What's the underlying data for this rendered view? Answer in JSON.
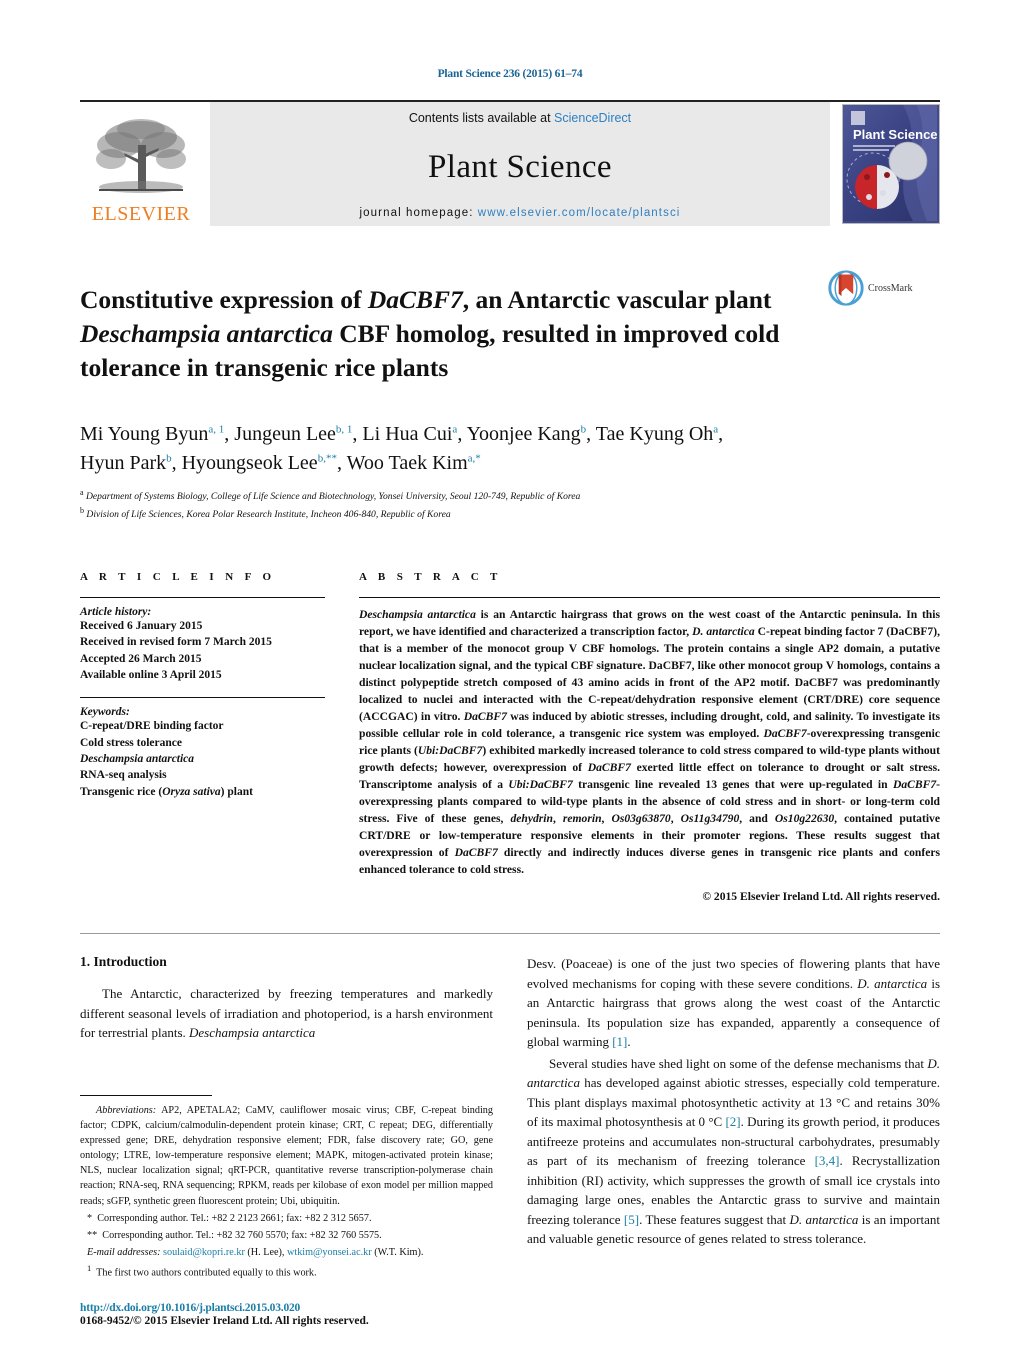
{
  "running_head": "Plant Science 236 (2015) 61–74",
  "masthead": {
    "contents_prefix": "Contents lists available at ",
    "contents_link": "ScienceDirect",
    "journal_title": "Plant Science",
    "homepage_prefix": "journal homepage: ",
    "homepage_url": "www.elsevier.com/locate/plantsci",
    "publisher_name": "ELSEVIER",
    "cover_title": "Plant Science",
    "cover_subtitle": "AN INTERNATIONAL JOURNAL OF EXPERIMENTAL PLANT BIOLOGY"
  },
  "article": {
    "title_line1_a": "Constitutive expression of ",
    "title_line1_italic": "DaCBF7",
    "title_line1_b": ", an Antarctic vascular plant",
    "title_line2_italic": "Deschampsia antarctica",
    "title_line2_b": " CBF homolog, resulted in improved cold",
    "title_line3": "tolerance in transgenic rice plants",
    "crossmark_label": "CrossMark"
  },
  "authors": {
    "line1": [
      {
        "name": "Mi Young Byun",
        "sup": "a, 1",
        "sep": ", "
      },
      {
        "name": "Jungeun Lee",
        "sup": "b, 1",
        "sep": ", "
      },
      {
        "name": "Li Hua Cui",
        "sup": "a",
        "sep": ", "
      },
      {
        "name": "Yoonjee Kang",
        "sup": "b",
        "sep": ", "
      },
      {
        "name": "Tae Kyung Oh",
        "sup": "a",
        "sep": ","
      }
    ],
    "line2": [
      {
        "name": "Hyun Park",
        "sup": "b",
        "sep": ", "
      },
      {
        "name": "Hyoungseok Lee",
        "sup": "b,**",
        "sep": ", "
      },
      {
        "name": "Woo Taek Kim",
        "sup": "a,*",
        "sep": ""
      }
    ],
    "affiliations": [
      {
        "marker": "a",
        "text": "Department of Systems Biology, College of Life Science and Biotechnology, Yonsei University, Seoul 120-749, Republic of Korea"
      },
      {
        "marker": "b",
        "text": "Division of Life Sciences, Korea Polar Research Institute, Incheon 406-840, Republic of Korea"
      }
    ]
  },
  "article_info": {
    "heading": "A R T I C L E   I N F O",
    "history_label": "Article history:",
    "history": [
      "Received 6 January 2015",
      "Received in revised form 7 March 2015",
      "Accepted 26 March 2015",
      "Available online 3 April 2015"
    ],
    "keywords_label": "Keywords:",
    "keywords": [
      "C-repeat/DRE binding factor",
      "Cold stress tolerance",
      "Deschampsia antarctica",
      "RNA-seq analysis",
      "Transgenic rice (Oryza sativa) plant"
    ]
  },
  "abstract": {
    "heading": "A B S T R A C T",
    "text": "Deschampsia antarctica is an Antarctic hairgrass that grows on the west coast of the Antarctic peninsula. In this report, we have identified and characterized a transcription factor, D. antarctica C-repeat binding factor 7 (DaCBF7), that is a member of the monocot group V CBF homologs. The protein contains a single AP2 domain, a putative nuclear localization signal, and the typical CBF signature. DaCBF7, like other monocot group V homologs, contains a distinct polypeptide stretch composed of 43 amino acids in front of the AP2 motif. DaCBF7 was predominantly localized to nuclei and interacted with the C-repeat/dehydration responsive element (CRT/DRE) core sequence (ACCGAC) in vitro. DaCBF7 was induced by abiotic stresses, including drought, cold, and salinity. To investigate its possible cellular role in cold tolerance, a transgenic rice system was employed. DaCBF7-overexpressing transgenic rice plants (Ubi:DaCBF7) exhibited markedly increased tolerance to cold stress compared to wild-type plants without growth defects; however, overexpression of DaCBF7 exerted little effect on tolerance to drought or salt stress. Transcriptome analysis of a Ubi:DaCBF7 transgenic line revealed 13 genes that were up-regulated in DaCBF7-overexpressing plants compared to wild-type plants in the absence of cold stress and in short- or long-term cold stress. Five of these genes, dehydrin, remorin, Os03g63870, Os11g34790, and Os10g22630, contained putative CRT/DRE or low-temperature responsive elements in their promoter regions. These results suggest that overexpression of DaCBF7 directly and indirectly induces diverse genes in transgenic rice plants and confers enhanced tolerance to cold stress.",
    "copyright": "© 2015 Elsevier Ireland Ltd. All rights reserved."
  },
  "introduction": {
    "section_title": "1. Introduction",
    "left_para1": "The Antarctic, characterized by freezing temperatures and markedly different seasonal levels of irradiation and photoperiod, is a harsh environment for terrestrial plants. Deschampsia antarctica",
    "right_para1": "Desv. (Poaceae) is one of the just two species of flowering plants that have evolved mechanisms for coping with these severe conditions. D. antarctica is an Antarctic hairgrass that grows along the west coast of the Antarctic peninsula. Its population size has expanded, apparently a consequence of global warming [1].",
    "right_para2": "Several studies have shed light on some of the defense mechanisms that D. antarctica has developed against abiotic stresses, especially cold temperature. This plant displays maximal photosynthetic activity at 13 °C and retains 30% of its maximal photosynthesis at 0 °C [2]. During its growth period, it produces antifreeze proteins and accumulates non-structural carbohydrates, presumably as part of its mechanism of freezing tolerance [3,4]. Recrystallization inhibition (RI) activity, which suppresses the growth of small ice crystals into damaging large ones, enables the Antarctic grass to survive and maintain freezing tolerance [5]. These features suggest that D. antarctica is an important and valuable genetic resource of genes related to stress tolerance."
  },
  "footnotes": {
    "abbrev_label": "Abbreviations:",
    "abbrev_text": " AP2, APETALA2; CaMV, cauliflower mosaic virus; CBF, C-repeat binding factor; CDPK, calcium/calmodulin-dependent protein kinase; CRT, C repeat; DEG, differentially expressed gene; DRE, dehydration responsive element; FDR, false discovery rate; GO, gene ontology; LTRE, low-temperature responsive element; MAPK, mitogen-activated protein kinase; NLS, nuclear localization signal; qRT-PCR, quantitative reverse transcription-polymerase chain reaction; RNA-seq, RNA sequencing; RPKM, reads per kilobase of exon model per million mapped reads; sGFP, synthetic green fluorescent protein; Ubi, ubiquitin.",
    "corr1_marker": "*",
    "corr1_text": "Corresponding author. Tel.: +82 2 2123 2661; fax: +82 2 312 5657.",
    "corr2_marker": "**",
    "corr2_text": "Corresponding author. Tel.: +82 32 760 5570; fax: +82 32 760 5575.",
    "email_label": "E-mail addresses:",
    "email1": "soulaid@kopri.re.kr",
    "email1_who": " (H. Lee), ",
    "email2": "wtkim@yonsei.ac.kr",
    "email2_who": " (W.T. Kim).",
    "equal_marker": "1",
    "equal_text": "The first two authors contributed equally to this work.",
    "doi_url": "http://dx.doi.org/10.1016/j.plantsci.2015.03.020",
    "issn_line": "0168-9452/© 2015 Elsevier Ireland Ltd. All rights reserved."
  },
  "colors": {
    "link_blue": "#1a7ea8",
    "sd_blue": "#2e7fc1",
    "elsevier_orange": "#ef7d22",
    "band_gray": "#e9e9e9"
  }
}
